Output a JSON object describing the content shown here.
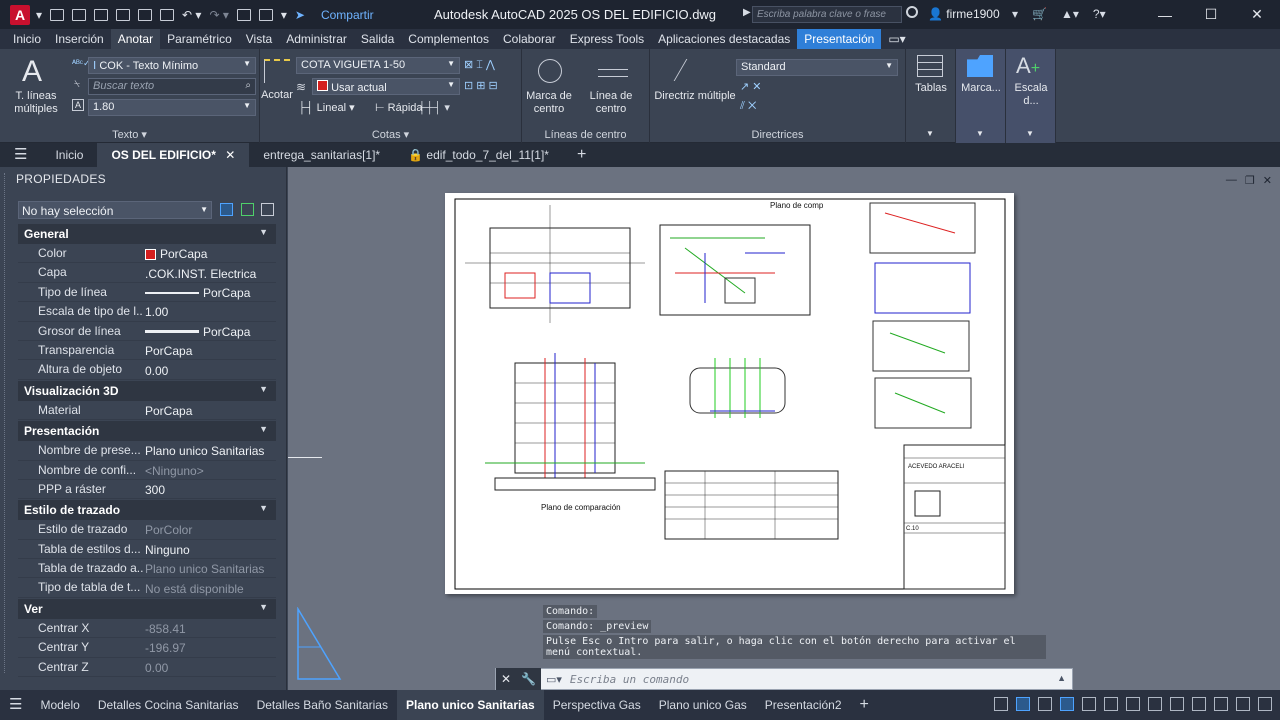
{
  "titlebar": {
    "app_letter": "A",
    "share": "Compartir",
    "title": "Autodesk AutoCAD 2025    OS DEL EDIFICIO.dwg",
    "search_placeholder": "Escriba palabra clave o frase",
    "user": "firme1900"
  },
  "menu": {
    "tabs": [
      "Inicio",
      "Inserción",
      "Anotar",
      "Paramétrico",
      "Vista",
      "Administrar",
      "Salida",
      "Complementos",
      "Colaborar",
      "Express Tools",
      "Aplicaciones destacadas",
      "Presentación"
    ]
  },
  "ribbon": {
    "texto": {
      "big_label": "T. líneas múltiples",
      "style_combo": "COK - Texto Mínimo",
      "find_placeholder": "Buscar texto",
      "height_combo": "1.80",
      "title": "Texto"
    },
    "cotas": {
      "big_label": "Acotar",
      "style_combo": "COTA VIGUETA 1-50",
      "layer_combo": "Usar actual",
      "lineal": "Lineal",
      "rapida": "Rápida",
      "title": "Cotas"
    },
    "centro": {
      "marca": "Marca de centro",
      "linea": "Línea de centro",
      "title": "Líneas de centro"
    },
    "directrices": {
      "label": "Directriz múltiple",
      "style_combo": "Standard",
      "title": "Directrices"
    },
    "tablas": "Tablas",
    "marca": "Marca...",
    "escala": "Escala d..."
  },
  "doctabs": [
    "Inicio",
    "OS DEL EDIFICIO*",
    "entrega_sanitarias[1]*",
    "edif_todo_7_del_11[1]*"
  ],
  "props": {
    "heading": "PROPIEDADES",
    "selection": "No hay selección",
    "sections": [
      {
        "name": "General",
        "rows": [
          {
            "k": "Color",
            "v": "PorCapa",
            "swatch": true
          },
          {
            "k": "Capa",
            "v": ".COK.INST. Electrica"
          },
          {
            "k": "Tipo de línea",
            "v": "PorCapa",
            "line": true
          },
          {
            "k": "Escala de tipo de l...",
            "v": "1.00"
          },
          {
            "k": "Grosor de línea",
            "v": "PorCapa",
            "line": true
          },
          {
            "k": "Transparencia",
            "v": "PorCapa"
          },
          {
            "k": "Altura de objeto",
            "v": "0.00"
          }
        ]
      },
      {
        "name": "Visualización 3D",
        "rows": [
          {
            "k": "Material",
            "v": "PorCapa"
          }
        ]
      },
      {
        "name": "Presentación",
        "rows": [
          {
            "k": "Nombre de prese...",
            "v": "Plano unico Sanitarias"
          },
          {
            "k": "Nombre de confi...",
            "v": "<Ninguno>",
            "dim": true
          },
          {
            "k": "PPP a ráster",
            "v": "300"
          }
        ]
      },
      {
        "name": "Estilo de trazado",
        "rows": [
          {
            "k": "Estilo de trazado",
            "v": "PorColor",
            "dim": true
          },
          {
            "k": "Tabla de estilos d...",
            "v": "Ninguno"
          },
          {
            "k": "Tabla de trazado a...",
            "v": "Plano unico Sanitarias",
            "dim": true
          },
          {
            "k": "Tipo de tabla de t...",
            "v": "No está disponible",
            "dim": true
          }
        ]
      },
      {
        "name": "Ver",
        "rows": [
          {
            "k": "Centrar X",
            "v": "-858.41",
            "dim": true
          },
          {
            "k": "Centrar Y",
            "v": "-196.97",
            "dim": true
          },
          {
            "k": "Centrar Z",
            "v": "0.00",
            "dim": true
          }
        ]
      }
    ]
  },
  "sheet": {
    "plan_title": "Plano de comp",
    "compare_label": "Plano de comparación",
    "owner": "ACEVEDO ARACELI",
    "sheet_code": "C.10"
  },
  "command": {
    "history": [
      "Comando:",
      "Comando: _preview",
      "Pulse Esc o Intro para salir, o haga clic con el botón derecho para activar el menú contextual."
    ],
    "placeholder": "Escriba un comando"
  },
  "layout_tabs": [
    "Modelo",
    "Detalles Cocina Sanitarias",
    "Detalles Baño Sanitarias",
    "Plano unico Sanitarias",
    "Perspectiva Gas",
    "Plano unico Gas",
    "Presentación2"
  ],
  "colors": {
    "accent": "#2f7fd8",
    "brand": "#c8102e",
    "bylayer": "#d41f1f"
  }
}
